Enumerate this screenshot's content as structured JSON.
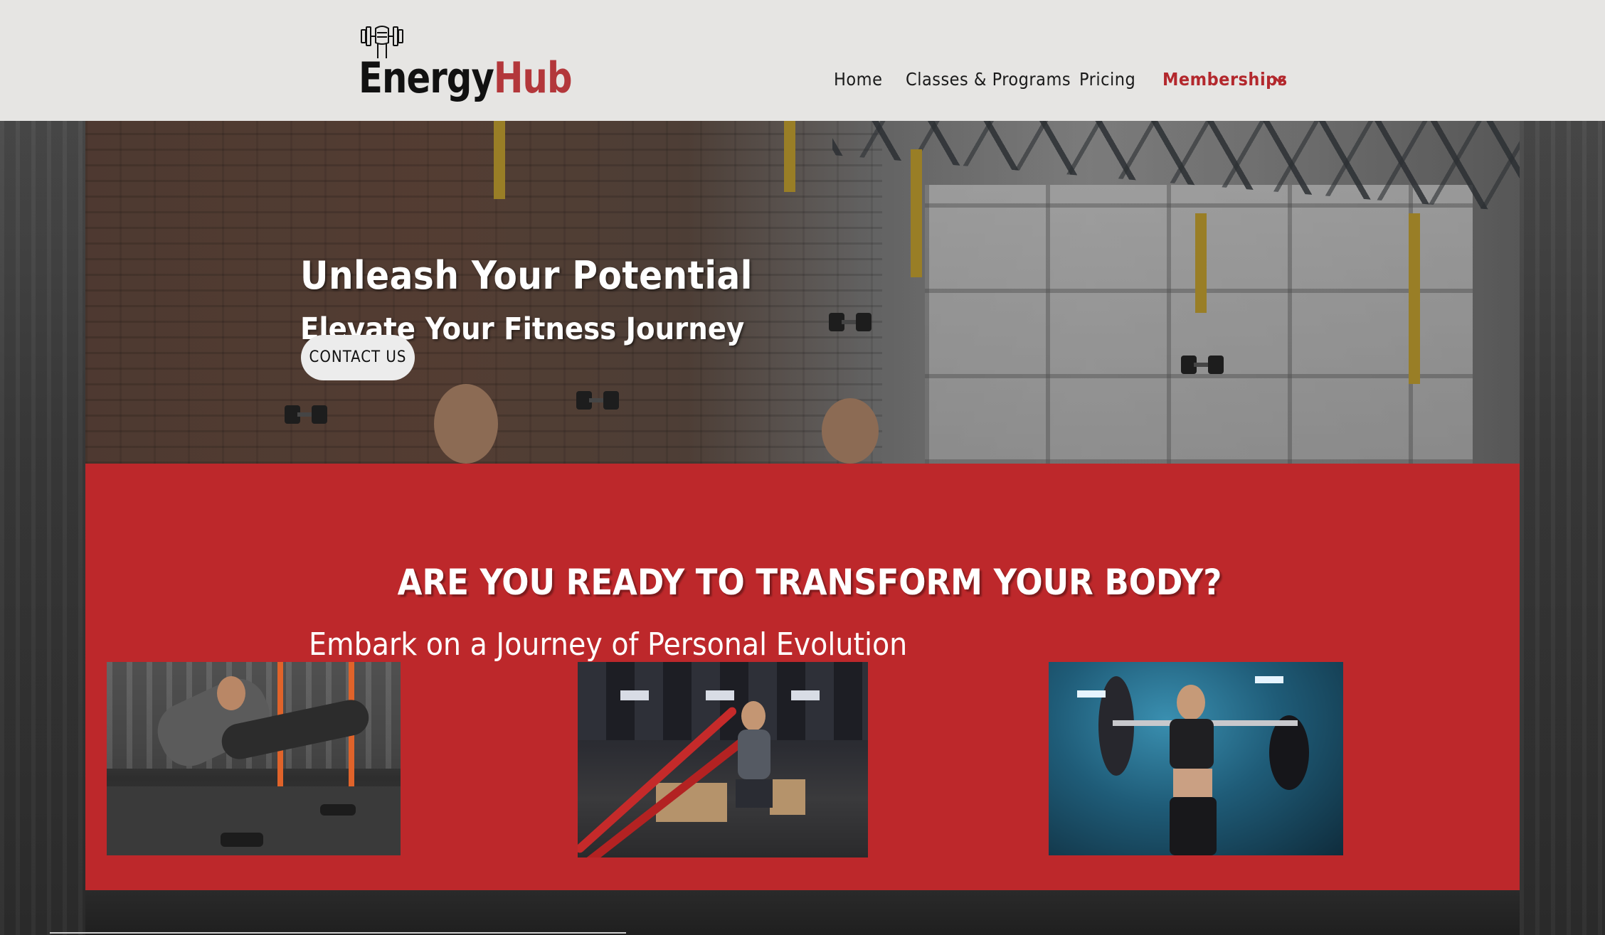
{
  "brand": {
    "part1": "Energy",
    "part2": "Hub",
    "icon": "fist-dumbbell-icon"
  },
  "nav": {
    "items": [
      {
        "label": "Home"
      },
      {
        "label": "Classes & Programs"
      },
      {
        "label": "Pricing"
      },
      {
        "label": "Memberships",
        "active": true,
        "icon": "chevron-down-icon"
      }
    ]
  },
  "hero": {
    "title": "Unleash Your Potential",
    "subtitle": "Elevate Your Fitness Journey",
    "cta_label": "CONTACT US"
  },
  "promo": {
    "title": "ARE YOU READY TO TRANSFORM YOUR BODY?",
    "subtitle": "Embark on a Journey of Personal Evolution",
    "images": [
      "group-dumbbell-plank-photo",
      "battle-ropes-photo",
      "barbell-squat-photo"
    ]
  },
  "colors": {
    "accent": "#bd282b",
    "header_bg": "#e6e5e3",
    "brand_red": "#b3373b"
  }
}
